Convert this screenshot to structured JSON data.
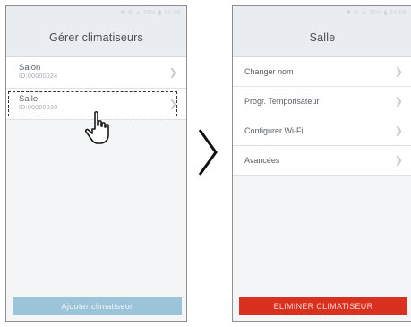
{
  "left_screen": {
    "status": "✱ ✆ ⊿ 75% ▮ 14:08",
    "title": "Gérer climatiseurs",
    "items": [
      {
        "name": "Salon",
        "id": "ID:00000024"
      },
      {
        "name": "Salle",
        "id": "ID:00000020"
      }
    ],
    "add_button": "Ajouter climatiseur"
  },
  "right_screen": {
    "status": "✱ ✆ ⊿ 75% ▮ 14:08",
    "title": "Salle",
    "menu": [
      "Changer nom",
      "Progr. Temporisateur",
      "Configurer Wi-Fi",
      "Avancées"
    ],
    "delete_button": "ELIMINER CLIMATISEUR"
  },
  "icons": {
    "chevron": "chevron-right-icon",
    "pointer": "hand-pointer-icon",
    "transition": "big-chevron-right-icon"
  },
  "colors": {
    "header_bg": "#e9edf1",
    "add_button_bg": "#9cc4d9",
    "delete_button_bg": "#d9301f"
  }
}
